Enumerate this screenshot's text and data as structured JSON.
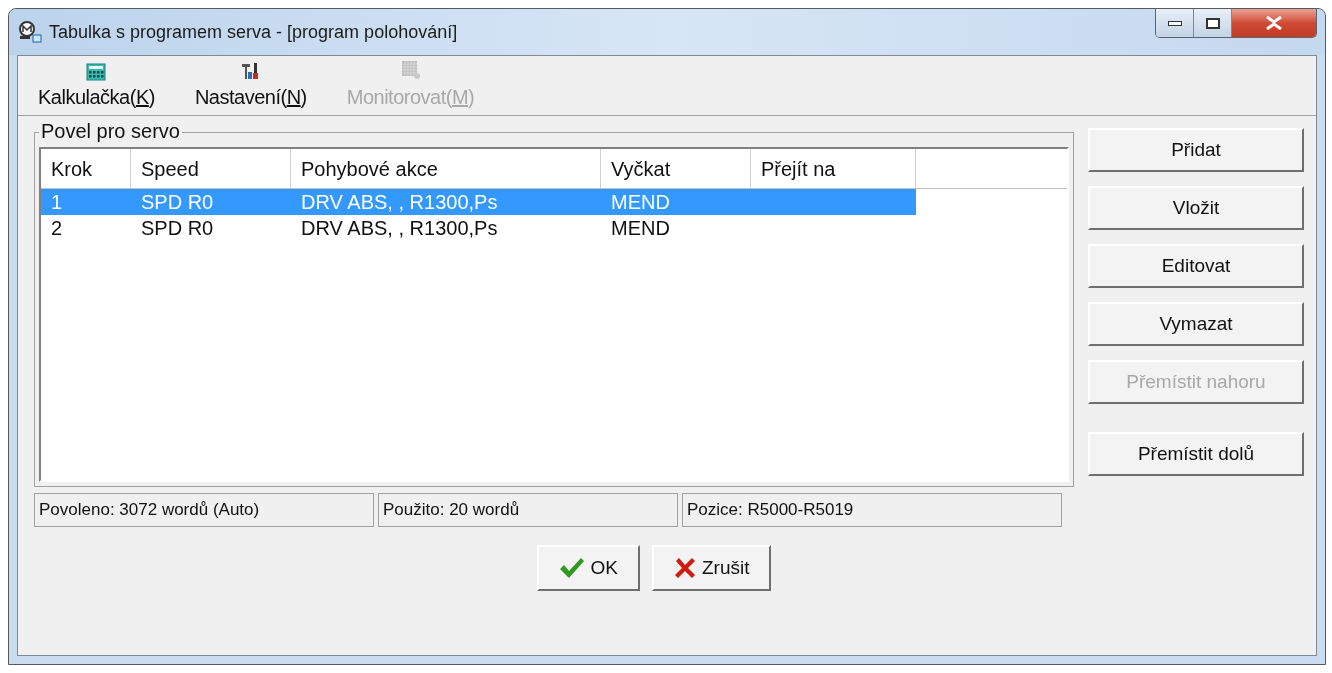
{
  "window": {
    "title": "Tabulka s programem serva - [program polohování]"
  },
  "toolbar": [
    {
      "kind": "calculator",
      "label_before": "Kalkulačka(",
      "accelerator": "K",
      "label_after": ")",
      "disabled": false
    },
    {
      "kind": "tools",
      "label_before": "Nastavení(",
      "accelerator": "N",
      "label_after": ")",
      "disabled": false
    },
    {
      "kind": "monitor",
      "label_before": "Monitorovat(",
      "accelerator": "M",
      "label_after": ")",
      "disabled": true
    }
  ],
  "group": {
    "title": "Povel pro servo"
  },
  "table": {
    "columns": [
      "Krok",
      "Speed",
      "Pohybové akce",
      "Vyčkat",
      "Přejít na"
    ],
    "rows": [
      {
        "cells": [
          "1",
          "SPD R0",
          "DRV ABS, , R1300,Ps",
          "MEND"
        ],
        "selected": true
      },
      {
        "cells": [
          "2",
          "SPD R0",
          "DRV ABS, , R1300,Ps",
          "MEND"
        ],
        "selected": false
      }
    ]
  },
  "status_bar": [
    "Povoleno: 3072 wordů (Auto)",
    "Použito: 20 wordů",
    "Pozice: R5000-R5019"
  ],
  "side_buttons": [
    {
      "label": "Přidat",
      "disabled": false
    },
    {
      "label": "Vložit",
      "disabled": false
    },
    {
      "label": "Editovat",
      "disabled": false
    },
    {
      "label": "Vymazat",
      "disabled": false
    },
    {
      "label": "Přemístit nahoru",
      "disabled": true
    },
    {
      "label": "Přemístit dolů",
      "disabled": false
    }
  ],
  "buttons": [
    {
      "kind": "ok",
      "label": "OK"
    },
    {
      "kind": "cancel",
      "label": "Zrušit"
    }
  ]
}
